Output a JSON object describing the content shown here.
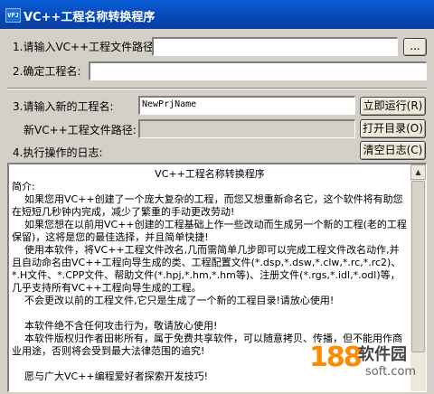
{
  "window": {
    "icon_text": "VPJ",
    "title": "VC++工程名称转换程序"
  },
  "form": {
    "step1_label": "1.请输入VC++工程文件路径:",
    "step1_value": "",
    "browse_label": "...",
    "step2_label": "2.确定工程名:",
    "step2_value": "",
    "step3_label": "3.请输入新的工程名:",
    "step3_value": "NewPrjName",
    "run_label": "立即运行(R)",
    "new_path_label": "新VC++工程文件路径:",
    "new_path_value": "",
    "open_dir_label": "打开目录(O)",
    "step4_label": "4.执行操作的日志:",
    "clear_log_label": "清空日志(C)"
  },
  "log": {
    "heading": "VC++工程名称转换程序",
    "paragraphs": [
      "简介:",
      "    如果您用VC++创建了一个庞大复杂的工程，而您又想重新命名它，这个软件将有助您在短短几秒钟内完成，减少了繁重的手动更改劳动!",
      "    如果您想在以前用VC++创建的工程基础上作一些改动而生成另一个新的工程(老的工程保留)，这将是您的最佳选择，并且简单快捷!",
      "    使用本软件，将VC++工程文件改名,几而需简单几步即可以完成工程文件改名动作,并且自动命名由VC++工程向导生成的类、工程配置文件(*.dsp,*.dsw,*.clw,*.rc,*.rc2)、*.H文件、*.CPP文件、帮助文件(*.hpj,*.hm,*.hm等)、注册文件(*.rgs,*.idl,*.odl)等，几乎支持所有VC++工程向导生成的工程。",
      "    不会更改以前的工程文件,它只是生成了一个新的工程目录!请放心使用!",
      "",
      "    本软件绝不含任何攻击行为，敬请放心使用!",
      "    本软件版权归作者田彬所有，属于免费共享软件，可以随意拷贝、传播，但不能用作商业用途，否则将会受到最大法律范围的追究!",
      "",
      "    愿与广大VC++编程爱好者探索开发技巧!"
    ]
  },
  "watermark": {
    "number": "188",
    "brand": "软件园",
    "url": "soft.com"
  }
}
